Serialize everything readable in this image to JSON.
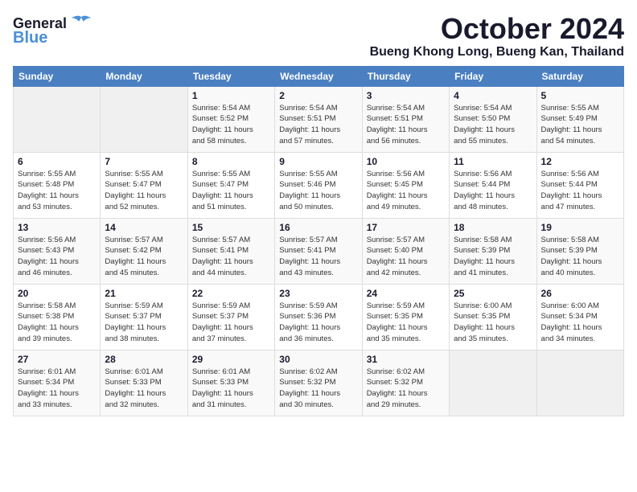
{
  "logo": {
    "line1": "General",
    "line2": "Blue"
  },
  "title": "October 2024",
  "location": "Bueng Khong Long, Bueng Kan, Thailand",
  "header": {
    "accent_color": "#4a7fc1"
  },
  "weekdays": [
    "Sunday",
    "Monday",
    "Tuesday",
    "Wednesday",
    "Thursday",
    "Friday",
    "Saturday"
  ],
  "weeks": [
    [
      {
        "day": "",
        "empty": true
      },
      {
        "day": "",
        "empty": true
      },
      {
        "day": "1",
        "sunrise": "Sunrise: 5:54 AM",
        "sunset": "Sunset: 5:52 PM",
        "daylight": "Daylight: 11 hours and 58 minutes."
      },
      {
        "day": "2",
        "sunrise": "Sunrise: 5:54 AM",
        "sunset": "Sunset: 5:51 PM",
        "daylight": "Daylight: 11 hours and 57 minutes."
      },
      {
        "day": "3",
        "sunrise": "Sunrise: 5:54 AM",
        "sunset": "Sunset: 5:51 PM",
        "daylight": "Daylight: 11 hours and 56 minutes."
      },
      {
        "day": "4",
        "sunrise": "Sunrise: 5:54 AM",
        "sunset": "Sunset: 5:50 PM",
        "daylight": "Daylight: 11 hours and 55 minutes."
      },
      {
        "day": "5",
        "sunrise": "Sunrise: 5:55 AM",
        "sunset": "Sunset: 5:49 PM",
        "daylight": "Daylight: 11 hours and 54 minutes."
      }
    ],
    [
      {
        "day": "6",
        "sunrise": "Sunrise: 5:55 AM",
        "sunset": "Sunset: 5:48 PM",
        "daylight": "Daylight: 11 hours and 53 minutes."
      },
      {
        "day": "7",
        "sunrise": "Sunrise: 5:55 AM",
        "sunset": "Sunset: 5:47 PM",
        "daylight": "Daylight: 11 hours and 52 minutes."
      },
      {
        "day": "8",
        "sunrise": "Sunrise: 5:55 AM",
        "sunset": "Sunset: 5:47 PM",
        "daylight": "Daylight: 11 hours and 51 minutes."
      },
      {
        "day": "9",
        "sunrise": "Sunrise: 5:55 AM",
        "sunset": "Sunset: 5:46 PM",
        "daylight": "Daylight: 11 hours and 50 minutes."
      },
      {
        "day": "10",
        "sunrise": "Sunrise: 5:56 AM",
        "sunset": "Sunset: 5:45 PM",
        "daylight": "Daylight: 11 hours and 49 minutes."
      },
      {
        "day": "11",
        "sunrise": "Sunrise: 5:56 AM",
        "sunset": "Sunset: 5:44 PM",
        "daylight": "Daylight: 11 hours and 48 minutes."
      },
      {
        "day": "12",
        "sunrise": "Sunrise: 5:56 AM",
        "sunset": "Sunset: 5:44 PM",
        "daylight": "Daylight: 11 hours and 47 minutes."
      }
    ],
    [
      {
        "day": "13",
        "sunrise": "Sunrise: 5:56 AM",
        "sunset": "Sunset: 5:43 PM",
        "daylight": "Daylight: 11 hours and 46 minutes."
      },
      {
        "day": "14",
        "sunrise": "Sunrise: 5:57 AM",
        "sunset": "Sunset: 5:42 PM",
        "daylight": "Daylight: 11 hours and 45 minutes."
      },
      {
        "day": "15",
        "sunrise": "Sunrise: 5:57 AM",
        "sunset": "Sunset: 5:41 PM",
        "daylight": "Daylight: 11 hours and 44 minutes."
      },
      {
        "day": "16",
        "sunrise": "Sunrise: 5:57 AM",
        "sunset": "Sunset: 5:41 PM",
        "daylight": "Daylight: 11 hours and 43 minutes."
      },
      {
        "day": "17",
        "sunrise": "Sunrise: 5:57 AM",
        "sunset": "Sunset: 5:40 PM",
        "daylight": "Daylight: 11 hours and 42 minutes."
      },
      {
        "day": "18",
        "sunrise": "Sunrise: 5:58 AM",
        "sunset": "Sunset: 5:39 PM",
        "daylight": "Daylight: 11 hours and 41 minutes."
      },
      {
        "day": "19",
        "sunrise": "Sunrise: 5:58 AM",
        "sunset": "Sunset: 5:39 PM",
        "daylight": "Daylight: 11 hours and 40 minutes."
      }
    ],
    [
      {
        "day": "20",
        "sunrise": "Sunrise: 5:58 AM",
        "sunset": "Sunset: 5:38 PM",
        "daylight": "Daylight: 11 hours and 39 minutes."
      },
      {
        "day": "21",
        "sunrise": "Sunrise: 5:59 AM",
        "sunset": "Sunset: 5:37 PM",
        "daylight": "Daylight: 11 hours and 38 minutes."
      },
      {
        "day": "22",
        "sunrise": "Sunrise: 5:59 AM",
        "sunset": "Sunset: 5:37 PM",
        "daylight": "Daylight: 11 hours and 37 minutes."
      },
      {
        "day": "23",
        "sunrise": "Sunrise: 5:59 AM",
        "sunset": "Sunset: 5:36 PM",
        "daylight": "Daylight: 11 hours and 36 minutes."
      },
      {
        "day": "24",
        "sunrise": "Sunrise: 5:59 AM",
        "sunset": "Sunset: 5:35 PM",
        "daylight": "Daylight: 11 hours and 35 minutes."
      },
      {
        "day": "25",
        "sunrise": "Sunrise: 6:00 AM",
        "sunset": "Sunset: 5:35 PM",
        "daylight": "Daylight: 11 hours and 35 minutes."
      },
      {
        "day": "26",
        "sunrise": "Sunrise: 6:00 AM",
        "sunset": "Sunset: 5:34 PM",
        "daylight": "Daylight: 11 hours and 34 minutes."
      }
    ],
    [
      {
        "day": "27",
        "sunrise": "Sunrise: 6:01 AM",
        "sunset": "Sunset: 5:34 PM",
        "daylight": "Daylight: 11 hours and 33 minutes."
      },
      {
        "day": "28",
        "sunrise": "Sunrise: 6:01 AM",
        "sunset": "Sunset: 5:33 PM",
        "daylight": "Daylight: 11 hours and 32 minutes."
      },
      {
        "day": "29",
        "sunrise": "Sunrise: 6:01 AM",
        "sunset": "Sunset: 5:33 PM",
        "daylight": "Daylight: 11 hours and 31 minutes."
      },
      {
        "day": "30",
        "sunrise": "Sunrise: 6:02 AM",
        "sunset": "Sunset: 5:32 PM",
        "daylight": "Daylight: 11 hours and 30 minutes."
      },
      {
        "day": "31",
        "sunrise": "Sunrise: 6:02 AM",
        "sunset": "Sunset: 5:32 PM",
        "daylight": "Daylight: 11 hours and 29 minutes."
      },
      {
        "day": "",
        "empty": true
      },
      {
        "day": "",
        "empty": true
      }
    ]
  ]
}
